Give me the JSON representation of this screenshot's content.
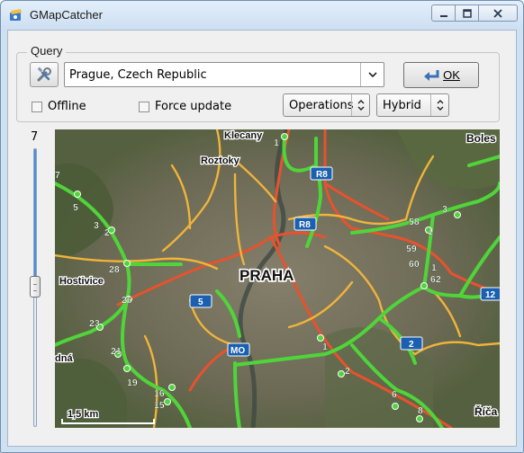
{
  "window": {
    "title": "GMapCatcher",
    "minimize_label": "▁",
    "maximize_label": "□",
    "close_label": "✕"
  },
  "query": {
    "legend": "Query",
    "location_value": "Prague, Czech Republic",
    "ok_label": "OK",
    "offline_label": "Offline",
    "force_update_label": "Force update",
    "operations_label": "Operations",
    "map_type_label": "Hybrid"
  },
  "zoom": {
    "level": "7",
    "level_fraction": 0.47
  },
  "map": {
    "labels": {
      "klecany": "Klecany",
      "roztoky": "Roztoky",
      "bolest": "Boles",
      "praha": "PRAHA",
      "hostivice": "Hostivice",
      "dna": "dná",
      "rica": "Říča",
      "scale": "1,5 km"
    },
    "road_shields": {
      "r8_top": "R8",
      "r8_mid": "R8",
      "d5": "5",
      "mo": "MO",
      "d2": "2",
      "d12": "12"
    },
    "exit_numbers": [
      "1",
      "7",
      "5",
      "3",
      "2",
      "28",
      "26",
      "23",
      "21",
      "19",
      "16",
      "15",
      "58",
      "3",
      "1",
      "59",
      "60",
      "1",
      "62",
      "1",
      "2",
      "6",
      "8"
    ],
    "colors": {
      "motorway": "#4fd53a",
      "primary": "#f0b43a",
      "trunk": "#e8522c",
      "shield": "#1a5fb0"
    }
  }
}
